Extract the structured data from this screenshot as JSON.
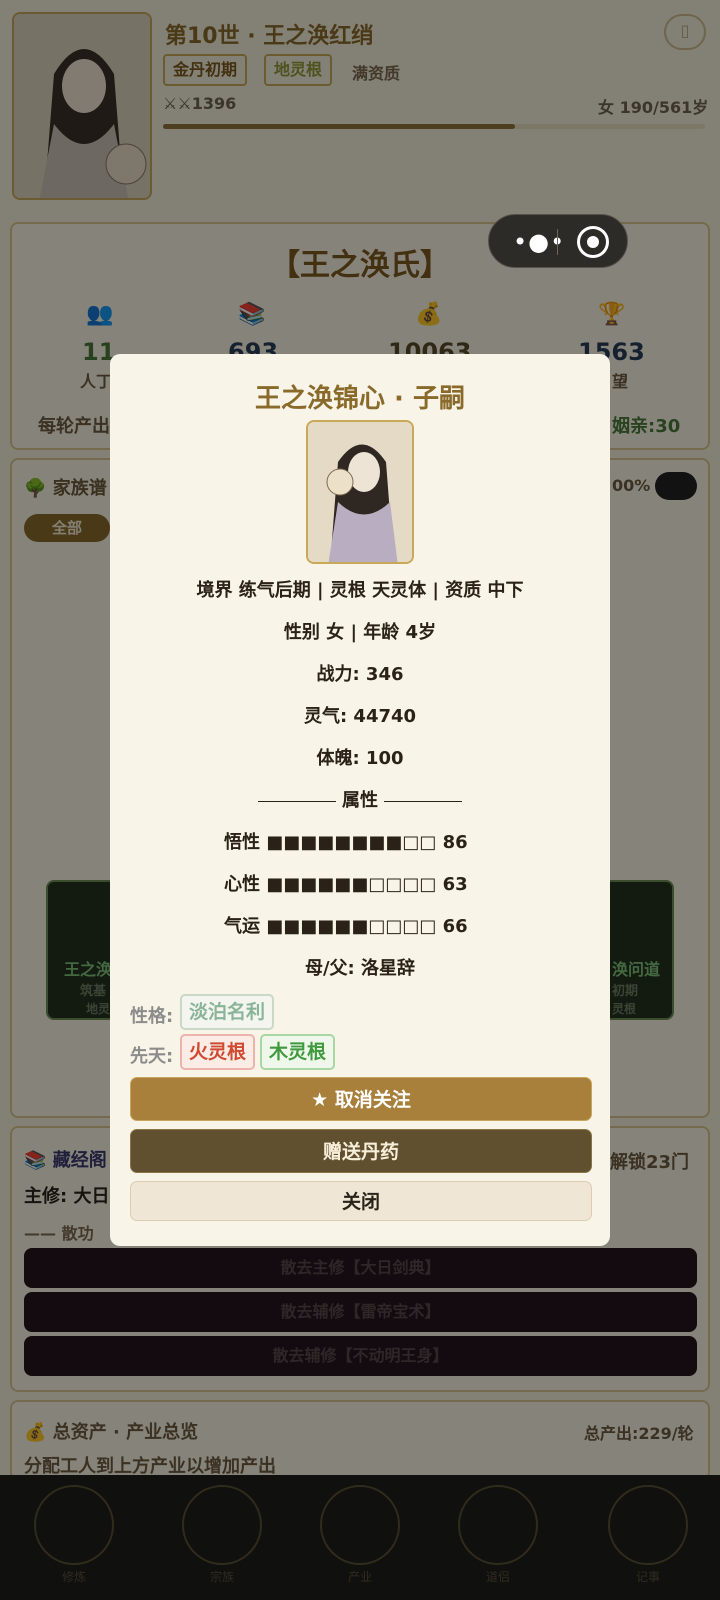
{
  "header": {
    "title": "第10世 · 王之涣红绡",
    "realm_badge": "金丹初期",
    "root_badge": "地灵根",
    "talent": "满资质",
    "power": "1396",
    "age": "女 190/561岁",
    "life_progress": 0.65
  },
  "clan": {
    "title": "【王之涣氏】",
    "stats": [
      {
        "icon": "people-icon",
        "value": "11",
        "label": "人丁"
      },
      {
        "icon": "books-icon",
        "value": "693",
        "label": ""
      },
      {
        "icon": "money-icon",
        "value": "10063",
        "label": ""
      },
      {
        "icon": "trophy-icon",
        "value": "1563",
        "label": "望"
      }
    ],
    "left_line": "每轮产出",
    "right_line": "姻亲:30"
  },
  "family": {
    "title": "家族谱",
    "percent": "00%",
    "filter_all": "全部",
    "left_card_name": "王之涣",
    "left_card_sub1": "筑基",
    "left_card_sub2": "地灵",
    "right_card_name": "涣问道",
    "right_card_sub1": "初期",
    "right_card_sub2": "灵根"
  },
  "library": {
    "title": "藏经阁",
    "unlock": "解锁23门",
    "main_label": "主修: 大日",
    "section": "散功",
    "buttons": [
      "散去主修【大日剑典】",
      "散去辅修【雷帝宝术】",
      "散去辅修【不动明王身】"
    ]
  },
  "assets": {
    "title": "总资产 · 产业总览",
    "total": "总产出:229/轮",
    "hint": "分配工人到上方产业以增加产出"
  },
  "nav": {
    "items": [
      "修炼",
      "宗族",
      "产业",
      "道侣",
      "记事"
    ]
  },
  "modal": {
    "title": "王之涣锦心 · 子嗣",
    "line1": "境界 练气后期 | 灵根 天灵体 | 资质 中下",
    "line2": "性别 女 | 年龄 4岁",
    "line3": "战力: 346",
    "line4": "灵气: 44740",
    "line5": "体魄: 100",
    "attr_header": "属性",
    "attrs": [
      {
        "label": "悟性",
        "bar": "■■■■■■■■□□",
        "value": "86"
      },
      {
        "label": "心性",
        "bar": "■■■■■■□□□□",
        "value": "63"
      },
      {
        "label": "气运",
        "bar": "■■■■■■□□□□",
        "value": "66"
      }
    ],
    "parent": "母/父: 洛星辞",
    "personality_label": "性格:",
    "personality": "淡泊名利",
    "innate_label": "先天:",
    "innate_fire": "火灵根",
    "innate_wood": "木灵根",
    "btn_unfollow": "★ 取消关注",
    "btn_gift": "赠送丹药",
    "btn_close": "关闭"
  }
}
